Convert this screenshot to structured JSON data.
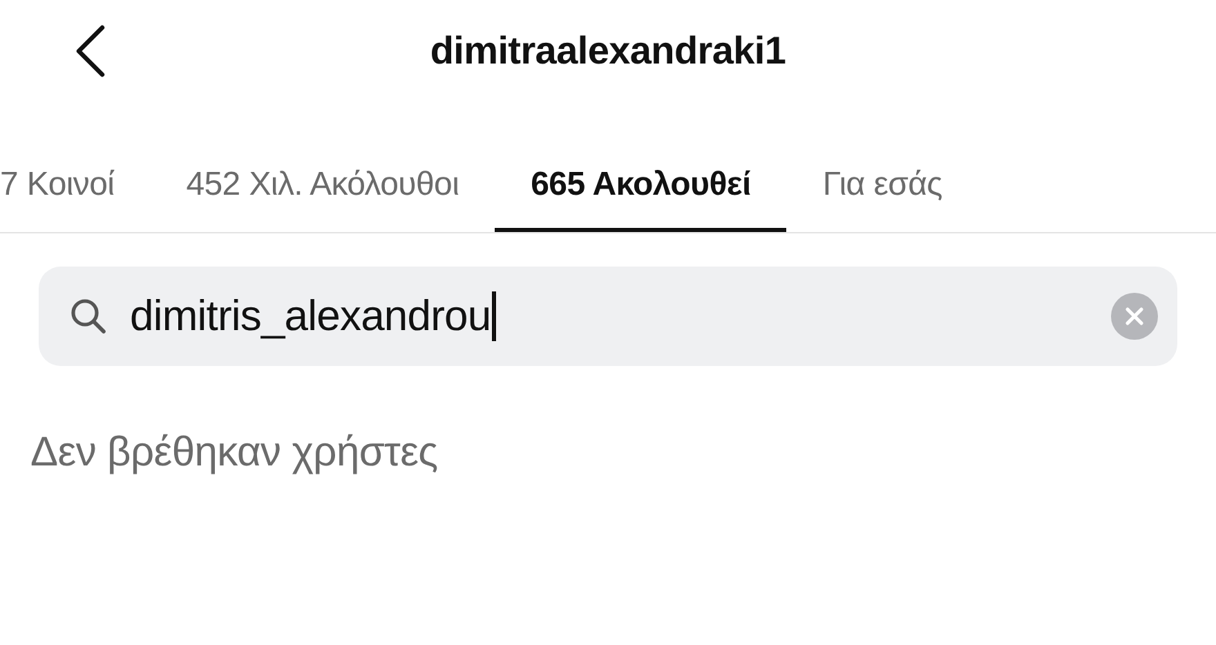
{
  "header": {
    "title": "dimitraalexandraki1"
  },
  "tabs": [
    {
      "label": "7 Κοινοί",
      "selected": false
    },
    {
      "label": "452 Χιλ. Ακόλουθοι",
      "selected": false
    },
    {
      "label": "665 Ακολουθεί",
      "selected": true
    },
    {
      "label": "Για εσάς",
      "selected": false
    }
  ],
  "search": {
    "value": "dimitris_alexandrou",
    "focused": true
  },
  "empty_message": "Δεν βρέθηκαν χρήστες"
}
